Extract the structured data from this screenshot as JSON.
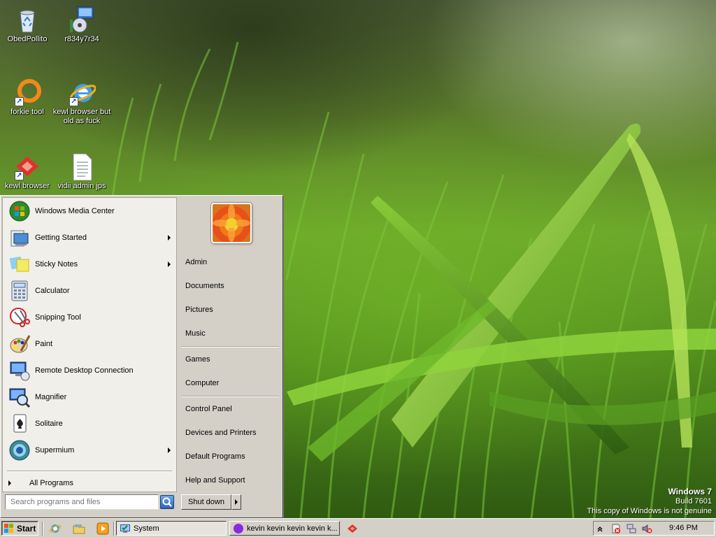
{
  "desktop": {
    "icons": [
      {
        "label": "ObedPollito",
        "icon": "recycle-bin-icon"
      },
      {
        "label": "r834y7r34",
        "icon": "installer-icon"
      },
      {
        "label": "forkie tool",
        "icon": "orange-ring-icon"
      },
      {
        "label": "kewl browser but old as fuck",
        "icon": "internet-explorer-icon"
      },
      {
        "label": "kewl browser",
        "icon": "red-browser-icon"
      },
      {
        "label": "vidii admin jps",
        "icon": "document-icon"
      }
    ]
  },
  "start_menu": {
    "programs": [
      {
        "label": "Windows Media Center",
        "icon": "media-center-icon",
        "submenu": false
      },
      {
        "label": "Getting Started",
        "icon": "getting-started-icon",
        "submenu": true
      },
      {
        "label": "Sticky Notes",
        "icon": "sticky-notes-icon",
        "submenu": true
      },
      {
        "label": "Calculator",
        "icon": "calculator-icon",
        "submenu": false
      },
      {
        "label": "Snipping Tool",
        "icon": "snipping-tool-icon",
        "submenu": false
      },
      {
        "label": "Paint",
        "icon": "paint-icon",
        "submenu": false
      },
      {
        "label": "Remote Desktop Connection",
        "icon": "remote-desktop-icon",
        "submenu": false
      },
      {
        "label": "Magnifier",
        "icon": "magnifier-icon",
        "submenu": false
      },
      {
        "label": "Solitaire",
        "icon": "solitaire-icon",
        "submenu": false
      },
      {
        "label": "Supermium",
        "icon": "supermium-icon",
        "submenu": true
      }
    ],
    "all_programs": "All Programs",
    "places": [
      {
        "label": "Admin",
        "group": 1
      },
      {
        "label": "Documents",
        "group": 1
      },
      {
        "label": "Pictures",
        "group": 1
      },
      {
        "label": "Music",
        "group": 1
      },
      {
        "label": "Games",
        "group": 2
      },
      {
        "label": "Computer",
        "group": 2
      },
      {
        "label": "Control Panel",
        "group": 3
      },
      {
        "label": "Devices and Printers",
        "group": 3
      },
      {
        "label": "Default Programs",
        "group": 3
      },
      {
        "label": "Help and Support",
        "group": 3
      }
    ],
    "search_placeholder": "Search programs and files",
    "shutdown_label": "Shut down"
  },
  "watermark": {
    "line1": "Windows 7",
    "line2": "Build 7601",
    "line3": "This copy of Windows is not genuine"
  },
  "taskbar": {
    "start_label": "Start",
    "quick_launch": [
      "internet-explorer-icon",
      "explorer-folder-icon",
      "media-player-icon"
    ],
    "tasks": [
      {
        "label": "System",
        "icon": "system-icon",
        "active": true
      },
      {
        "label": "kevin kevin kevin kevin k...",
        "icon": "purple-circle-icon",
        "active": false
      },
      {
        "label": "",
        "icon": "red-browser-icon",
        "active": false
      }
    ],
    "clock": "9:46 PM"
  },
  "colors": {
    "face": "#d4d0c8",
    "pane": "#f0efe9",
    "accent_blue": "#0046d5"
  }
}
